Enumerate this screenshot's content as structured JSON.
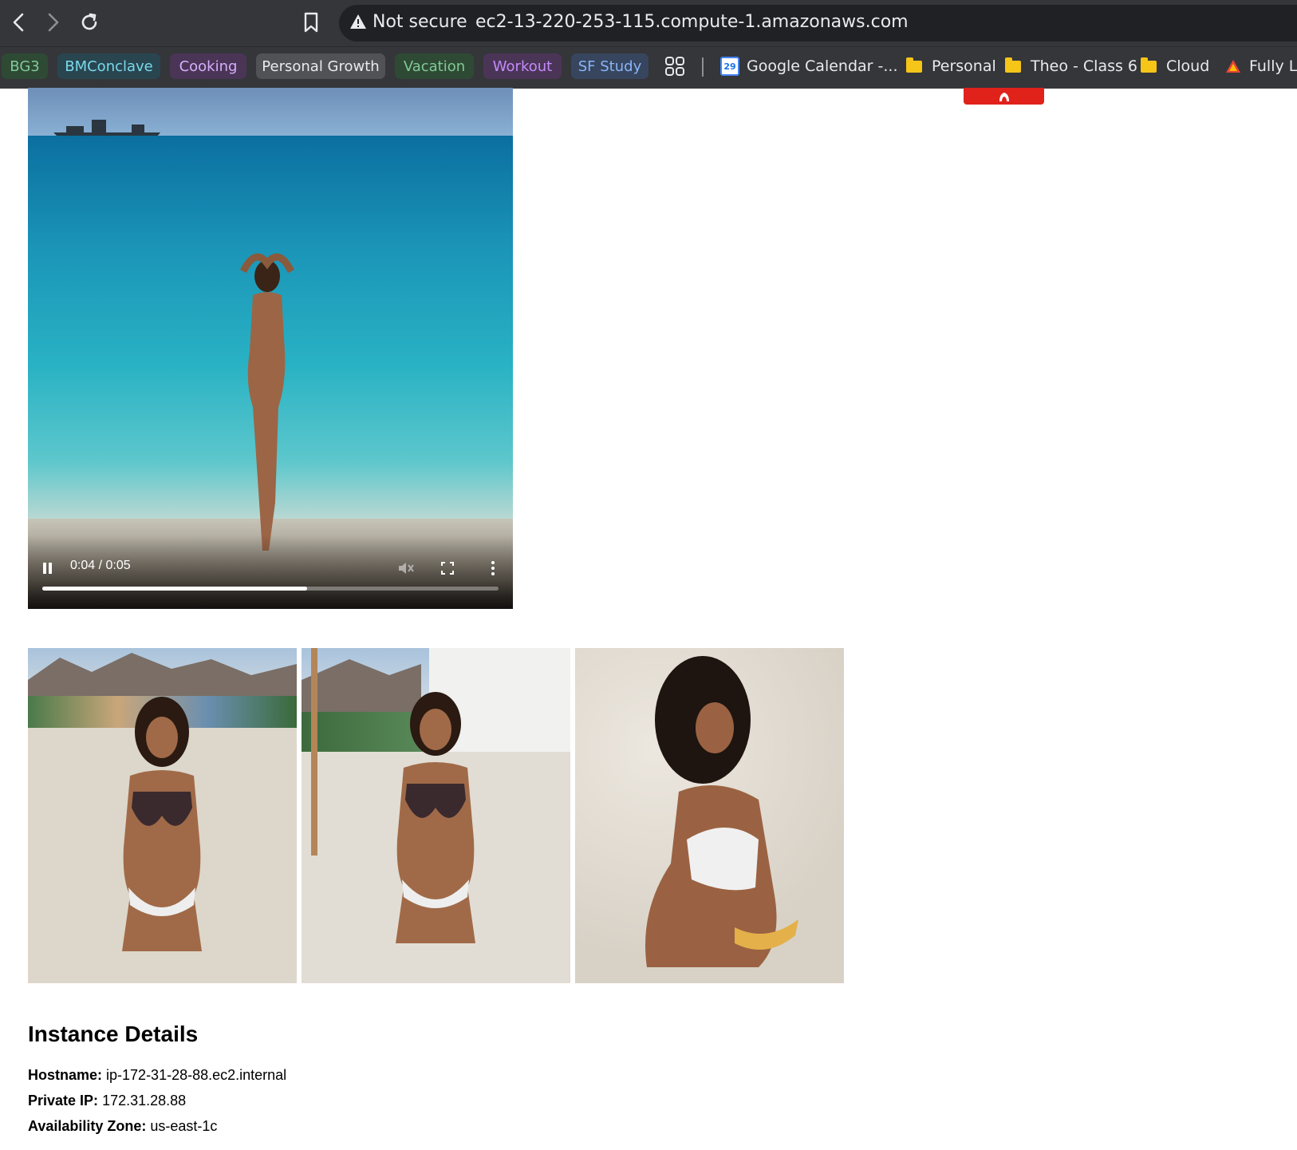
{
  "browser": {
    "security_label": "Not secure",
    "url": "ec2-13-220-253-115.compute-1.amazonaws.com",
    "tab_groups": [
      {
        "label": "BG3",
        "bg": "#2e4a35",
        "fg": "#81c995"
      },
      {
        "label": "BMConclave",
        "bg": "#294650",
        "fg": "#78d9ec"
      },
      {
        "label": "Cooking",
        "bg": "#4a3557",
        "fg": "#d7aefb"
      },
      {
        "label": "Personal Growth",
        "bg": "#505256",
        "fg": "#e8eaed"
      },
      {
        "label": "Vacation",
        "bg": "#2e4a35",
        "fg": "#81c995"
      },
      {
        "label": "Workout",
        "bg": "#4a3557",
        "fg": "#c58af9"
      },
      {
        "label": "SF Study",
        "bg": "#37465e",
        "fg": "#8ab4f8"
      }
    ],
    "bookmarks": [
      {
        "label": "Google Calendar -...",
        "icon": "google-calendar-icon",
        "icon_text": "29"
      },
      {
        "label": "Personal",
        "icon": "folder-icon"
      },
      {
        "label": "Theo - Class 6",
        "icon": "folder-icon"
      },
      {
        "label": "Cloud",
        "icon": "folder-icon"
      },
      {
        "label": "Fully Liv",
        "icon": "red-triangle-icon"
      }
    ]
  },
  "video": {
    "time_display": "0:04 / 0:05",
    "progress_fraction": 0.58
  },
  "instance": {
    "heading": "Instance Details",
    "hostname_label": "Hostname:",
    "hostname": "ip-172-31-28-88.ec2.internal",
    "private_ip_label": "Private IP:",
    "private_ip": "172.31.28.88",
    "az_label": "Availability Zone:",
    "az": "us-east-1c"
  }
}
